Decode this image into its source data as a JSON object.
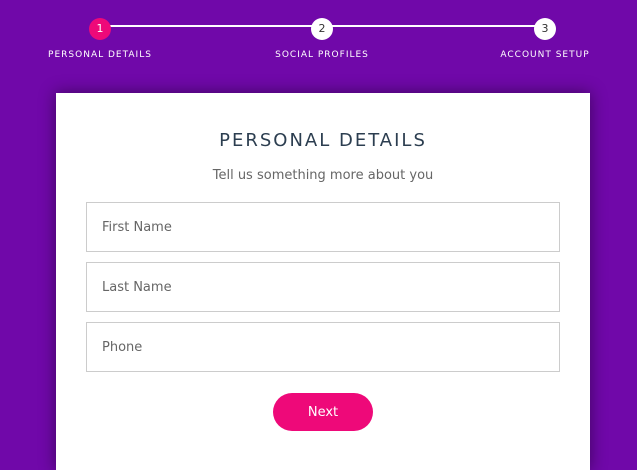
{
  "progress": {
    "steps": [
      {
        "number": "1",
        "label": "PERSONAL DETAILS",
        "active": true
      },
      {
        "number": "2",
        "label": "SOCIAL PROFILES",
        "active": false
      },
      {
        "number": "3",
        "label": "ACCOUNT SETUP",
        "active": false
      }
    ]
  },
  "form": {
    "title": "PERSONAL DETAILS",
    "subtitle": "Tell us something more about you",
    "fields": {
      "first_name": {
        "placeholder": "First Name",
        "value": ""
      },
      "last_name": {
        "placeholder": "Last Name",
        "value": ""
      },
      "phone": {
        "placeholder": "Phone",
        "value": ""
      }
    },
    "next_label": "Next"
  },
  "colors": {
    "background": "#7008a9",
    "accent": "#ee0979",
    "card": "#ffffff",
    "title_text": "#2c3e50"
  }
}
